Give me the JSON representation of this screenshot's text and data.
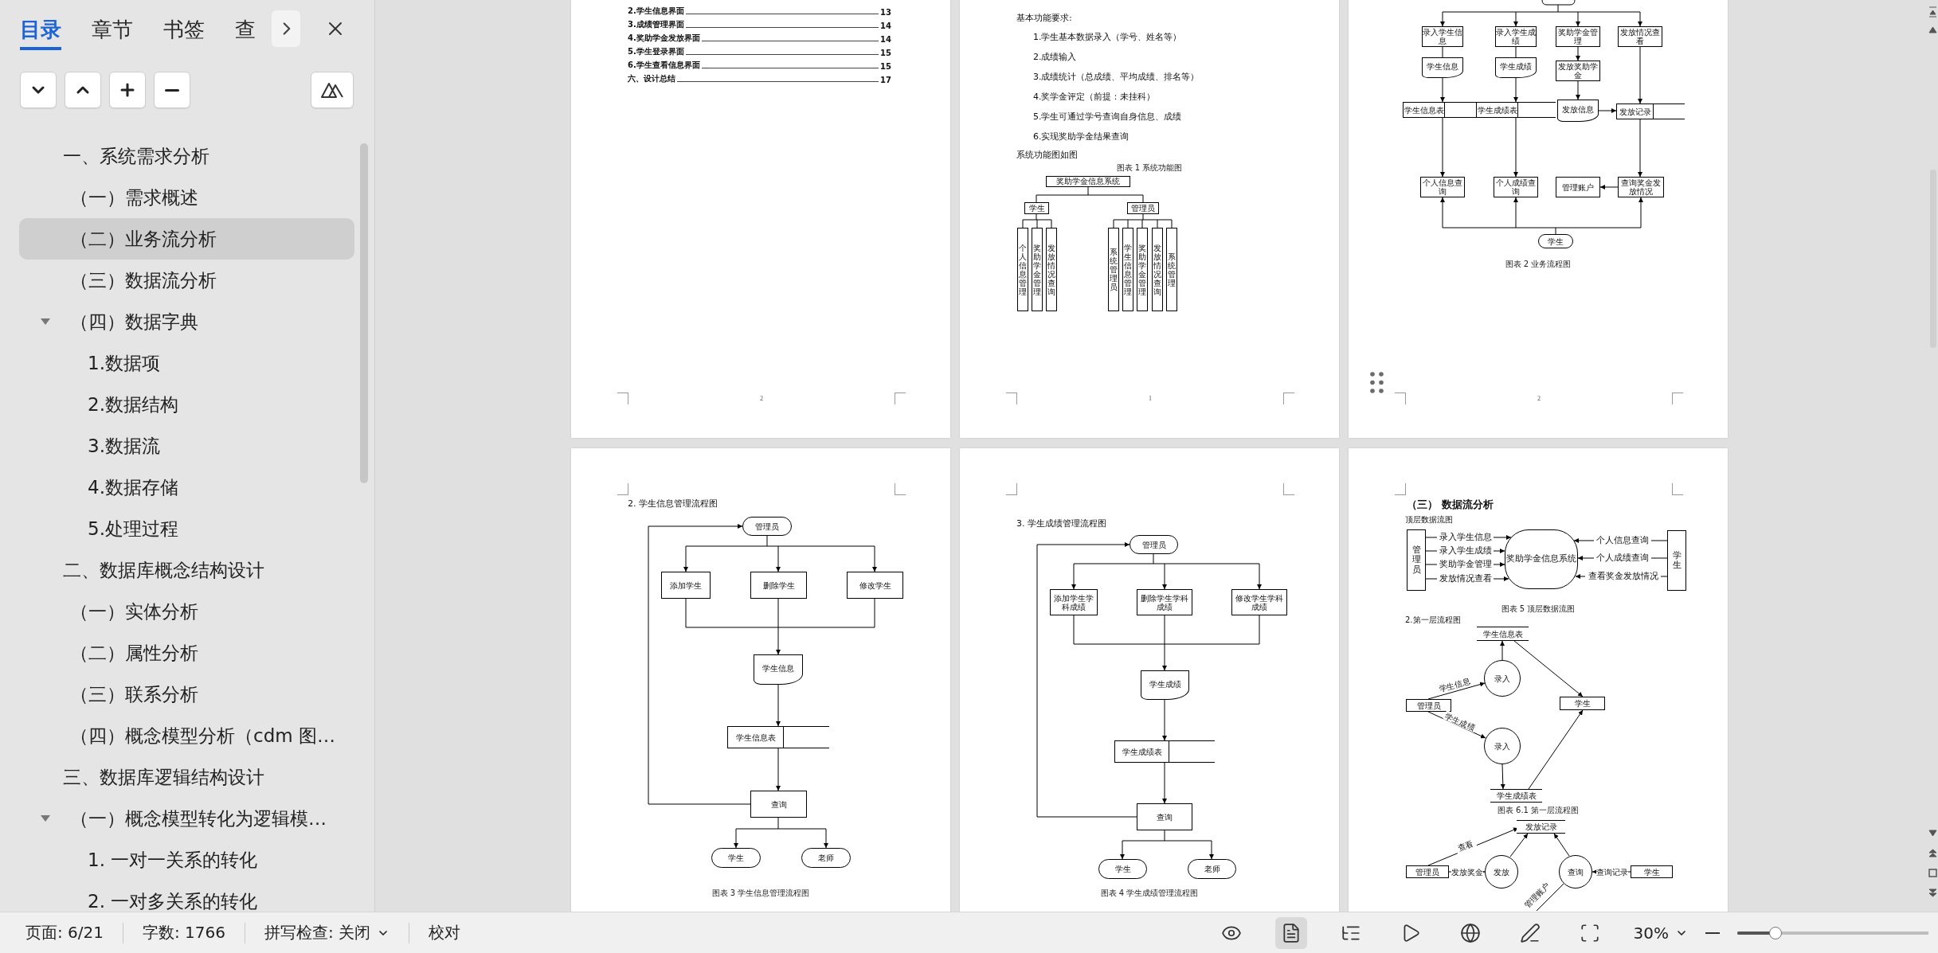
{
  "sidebar": {
    "tabs": [
      {
        "label": "目录",
        "selected": true
      },
      {
        "label": "章节",
        "selected": false
      },
      {
        "label": "书签",
        "selected": false
      },
      {
        "label": "查",
        "selected": false
      }
    ],
    "outline": [
      {
        "label": "一、系统需求分析",
        "selected": false,
        "children": [
          {
            "label": "（一）需求概述",
            "selected": false
          },
          {
            "label": "（二）业务流分析",
            "selected": true
          },
          {
            "label": "（三）数据流分析",
            "selected": false
          },
          {
            "label": "（四）数据字典",
            "selected": false,
            "expanded": true,
            "children": [
              {
                "label": "1.数据项",
                "selected": false
              },
              {
                "label": "2.数据结构",
                "selected": false
              },
              {
                "label": "3.数据流",
                "selected": false
              },
              {
                "label": "4.数据存储",
                "selected": false
              },
              {
                "label": "5.处理过程",
                "selected": false
              }
            ]
          }
        ]
      },
      {
        "label": "二、数据库概念结构设计",
        "selected": false,
        "children": [
          {
            "label": "（一）实体分析",
            "selected": false
          },
          {
            "label": "（二）属性分析",
            "selected": false
          },
          {
            "label": "（三）联系分析",
            "selected": false
          },
          {
            "label": "（四）概念模型分析（cdm 图…",
            "selected": false
          }
        ]
      },
      {
        "label": "三、数据库逻辑结构设计",
        "selected": false,
        "children": [
          {
            "label": "（一）概念模型转化为逻辑模…",
            "selected": false,
            "expanded": true,
            "children": [
              {
                "label": "1. 一对一关系的转化",
                "selected": false
              },
              {
                "label": "2. 一对多关系的转化",
                "selected": false
              }
            ]
          }
        ]
      }
    ]
  },
  "pages": [
    {
      "blocks": [
        {
          "kind": "toc",
          "entries": [
            {
              "title": "2.学生信息界面",
              "page": "13"
            },
            {
              "title": "3.成绩管理界面",
              "page": "14"
            },
            {
              "title": "4.奖助学金发放界面",
              "page": "14"
            },
            {
              "title": "5.学生登录界面",
              "page": "15"
            },
            {
              "title": "6.学生查看信息界面",
              "page": "15"
            },
            {
              "title": "六、设计总结",
              "page": "17"
            }
          ]
        }
      ],
      "page_number": "2"
    },
    {
      "blocks": [
        {
          "kind": "text",
          "text": "基本功能要求:"
        },
        {
          "kind": "list-item",
          "text": "1.学生基本数据录入（学号、姓名等）"
        },
        {
          "kind": "list-item",
          "text": "2.成绩输入"
        },
        {
          "kind": "list-item",
          "text": "3.成绩统计（总成绩、平均成绩、排名等）"
        },
        {
          "kind": "list-item",
          "text": "4.奖学金评定（前提：未挂科）"
        },
        {
          "kind": "list-item",
          "text": "5.学生可通过学号查询自身信息、成绩"
        },
        {
          "kind": "list-item",
          "text": "6.实现奖助学金结果查询"
        },
        {
          "kind": "text",
          "text": "系统功能图如图"
        },
        {
          "kind": "caption",
          "text": "图表 1 系统功能图"
        },
        {
          "kind": "diagram",
          "nodes": [
            {
              "kind": "box",
              "label": "奖助学金信息系统"
            },
            {
              "kind": "box",
              "label": "学生"
            },
            {
              "kind": "box",
              "label": "管理员"
            },
            {
              "kind": "vertical-box",
              "label": "个人信息管理"
            },
            {
              "kind": "vertical-box",
              "label": "奖助学金管理"
            },
            {
              "kind": "vertical-box",
              "label": "发放情况查询"
            },
            {
              "kind": "vertical-box",
              "label": "系统管理员"
            },
            {
              "kind": "vertical-box",
              "label": "学生信息管理"
            },
            {
              "kind": "vertical-box",
              "label": "奖助学金管理"
            },
            {
              "kind": "vertical-box",
              "label": "发放情况查询"
            },
            {
              "kind": "vertical-box",
              "label": "系统管理"
            }
          ]
        }
      ],
      "page_number": "1"
    },
    {
      "blocks": [
        {
          "kind": "diagram",
          "nodes": [
            {
              "kind": "process",
              "label": "录入学生信息"
            },
            {
              "kind": "process",
              "label": "录入学生成绩"
            },
            {
              "kind": "process",
              "label": "奖助学金管理"
            },
            {
              "kind": "process",
              "label": "发放情况查看"
            },
            {
              "kind": "document",
              "label": "学生信息"
            },
            {
              "kind": "document",
              "label": "学生成绩"
            },
            {
              "kind": "process",
              "label": "发放奖助学金"
            },
            {
              "kind": "table",
              "label": "学生信息表"
            },
            {
              "kind": "table",
              "label": "学生成绩表"
            },
            {
              "kind": "document",
              "label": "发放信息"
            },
            {
              "kind": "table",
              "label": "发放记录"
            },
            {
              "kind": "process",
              "label": "个人信息查询"
            },
            {
              "kind": "process",
              "label": "个人成绩查询"
            },
            {
              "kind": "process",
              "label": "管理账户"
            },
            {
              "kind": "process",
              "label": "查询奖金发放情况"
            },
            {
              "kind": "terminal",
              "label": "学生"
            }
          ]
        },
        {
          "kind": "caption",
          "text": "图表 2 业务流程图"
        }
      ],
      "page_number": "2"
    },
    {
      "blocks": [
        {
          "kind": "text",
          "text": "2. 学生信息管理流程图"
        },
        {
          "kind": "diagram",
          "nodes": [
            {
              "kind": "terminal",
              "label": "管理员"
            },
            {
              "kind": "process",
              "label": "添加学生"
            },
            {
              "kind": "process",
              "label": "删除学生"
            },
            {
              "kind": "process",
              "label": "修改学生"
            },
            {
              "kind": "document",
              "label": "学生信息"
            },
            {
              "kind": "table",
              "label": "学生信息表"
            },
            {
              "kind": "process",
              "label": "查询"
            },
            {
              "kind": "terminal",
              "label": "学生"
            },
            {
              "kind": "terminal",
              "label": "老师"
            }
          ]
        },
        {
          "kind": "caption",
          "text": "图表 3 学生信息管理流程图"
        }
      ]
    },
    {
      "blocks": [
        {
          "kind": "text",
          "text": "3. 学生成绩管理流程图"
        },
        {
          "kind": "diagram",
          "nodes": [
            {
              "kind": "terminal",
              "label": "管理员"
            },
            {
              "kind": "process",
              "label": "添加学生学科成绩"
            },
            {
              "kind": "process",
              "label": "删除学生学科成绩"
            },
            {
              "kind": "process",
              "label": "修改学生学科成绩"
            },
            {
              "kind": "document",
              "label": "学生成绩"
            },
            {
              "kind": "table",
              "label": "学生成绩表"
            },
            {
              "kind": "process",
              "label": "查询"
            },
            {
              "kind": "terminal",
              "label": "学生"
            },
            {
              "kind": "terminal",
              "label": "老师"
            }
          ]
        },
        {
          "kind": "caption",
          "text": "图表 4 学生成绩管理流程图"
        }
      ]
    },
    {
      "blocks": [
        {
          "kind": "heading",
          "text": "（三） 数据流分析"
        },
        {
          "kind": "note",
          "text": "顶层数据流图"
        },
        {
          "kind": "diagram",
          "nodes": [
            {
              "kind": "vertical-entity",
              "label": "管理员"
            },
            {
              "kind": "flow-label",
              "label": "录入学生信息"
            },
            {
              "kind": "flow-label",
              "label": "录入学生成绩"
            },
            {
              "kind": "flow-label",
              "label": "奖助学金管理"
            },
            {
              "kind": "flow-label",
              "label": "发放情况查看"
            },
            {
              "kind": "oval",
              "label": "奖助学金信息系统"
            },
            {
              "kind": "flow-label",
              "label": "个人信息查询"
            },
            {
              "kind": "flow-label",
              "label": "个人成绩查询"
            },
            {
              "kind": "flow-label",
              "label": "查看奖金发放情况"
            },
            {
              "kind": "vertical-entity",
              "label": "学生"
            }
          ]
        },
        {
          "kind": "caption",
          "text": "图表 5 顶层数据流图"
        },
        {
          "kind": "note",
          "text": "2.第一层流程图"
        },
        {
          "kind": "diagram",
          "nodes": [
            {
              "kind": "store",
              "label": "学生信息表"
            },
            {
              "kind": "circle",
              "label": "录入"
            },
            {
              "kind": "flow-label",
              "label": "学生信息"
            },
            {
              "kind": "entity",
              "label": "管理员"
            },
            {
              "kind": "entity",
              "label": "学生"
            },
            {
              "kind": "flow-label",
              "label": "学生成绩"
            },
            {
              "kind": "circle",
              "label": "录入"
            },
            {
              "kind": "store",
              "label": "学生成绩表"
            }
          ]
        },
        {
          "kind": "caption",
          "text": "图表 6.1 第一层流程图"
        },
        {
          "kind": "diagram",
          "nodes": [
            {
              "kind": "store",
              "label": "发放记录"
            },
            {
              "kind": "flow-label",
              "label": "查看"
            },
            {
              "kind": "entity",
              "label": "管理员"
            },
            {
              "kind": "flow-label",
              "label": "发放奖金"
            },
            {
              "kind": "circle",
              "label": "发放"
            },
            {
              "kind": "circle",
              "label": "查询"
            },
            {
              "kind": "flow-label",
              "label": "查询记录"
            },
            {
              "kind": "entity",
              "label": "学生"
            },
            {
              "kind": "flow-label",
              "label": "管理账户"
            }
          ]
        }
      ]
    }
  ],
  "status_bar": {
    "page": "页面: 6/21",
    "word_count": "字数: 1766",
    "spellcheck": "拼写检查: 关闭",
    "proofread": "校对",
    "view_buttons": [
      {
        "kind": "eye",
        "selected": false
      },
      {
        "kind": "page",
        "selected": true
      },
      {
        "kind": "outline",
        "selected": false
      },
      {
        "kind": "play",
        "selected": false
      },
      {
        "kind": "globe",
        "selected": false
      },
      {
        "kind": "pen",
        "selected": false
      },
      {
        "kind": "fit",
        "selected": false
      }
    ],
    "zoom": {
      "value": "30%",
      "level": 0.2
    }
  }
}
